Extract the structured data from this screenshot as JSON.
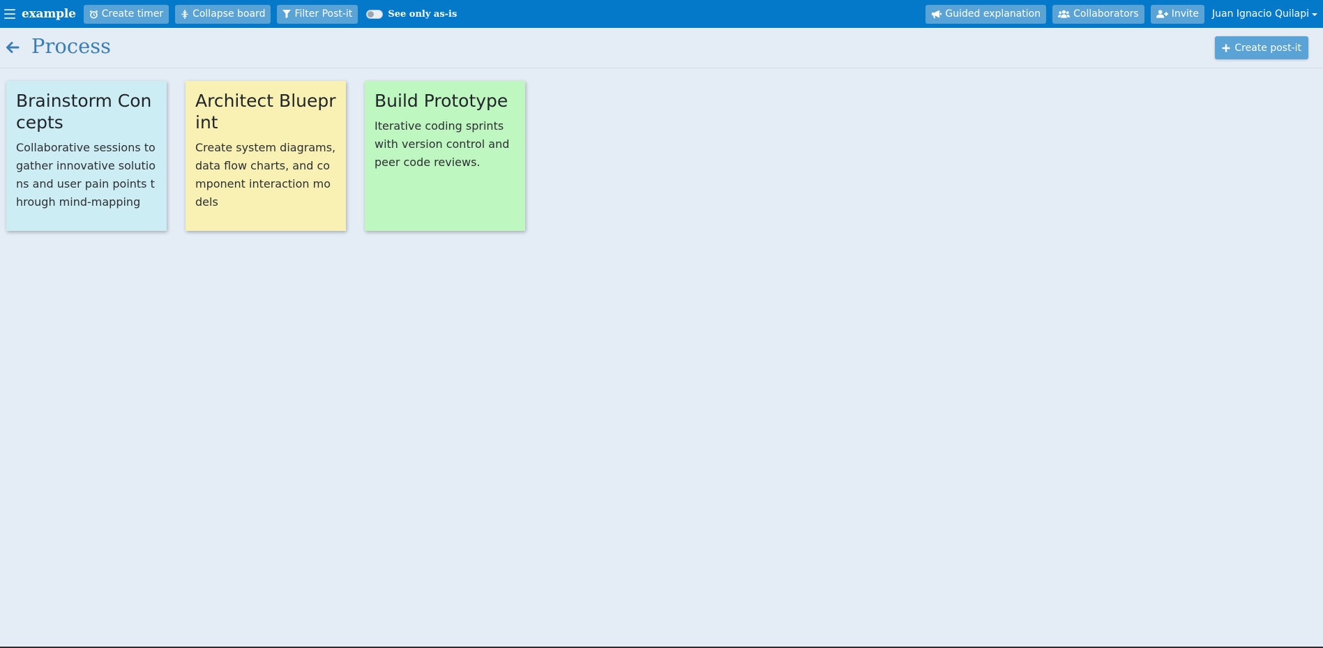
{
  "navbar": {
    "brand": "example",
    "create_timer": "Create timer",
    "collapse_board": "Collapse board",
    "filter_postit": "Filter Post-it",
    "see_only_label": "See only as-is",
    "guided_explanation": "Guided explanation",
    "collaborators": "Collaborators",
    "invite": "Invite",
    "user_name": "Juan Ignacio Quilapi"
  },
  "page": {
    "title": "Process",
    "create_postit": "Create post-it"
  },
  "postits": [
    {
      "title": "Brainstorm Concepts",
      "description": "Collaborative sessions to gather innovative solutions and user pain points through mind-mapping",
      "color": "#cdedf4"
    },
    {
      "title": "Architect Blueprint",
      "description": "Create system diagrams, data flow charts, and component interaction models",
      "color": "#f8f1b3"
    },
    {
      "title": "Build Prototype",
      "description": "Iterative coding sprints with version control and peer code reviews.",
      "color": "#bff7c0"
    }
  ],
  "colors": {
    "navbar": "#0579c9",
    "button": "#5aa3d6",
    "background": "#e4ecf6",
    "title": "#3a7fb3"
  }
}
